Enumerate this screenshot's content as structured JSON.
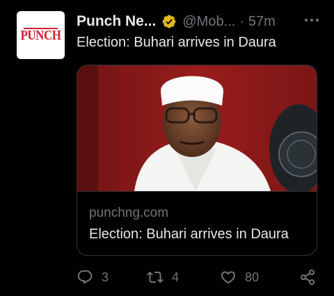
{
  "avatar": {
    "logo_text": "PUNCH"
  },
  "header": {
    "display_name": "Punch Ne...",
    "handle": "@Mob...",
    "separator": "·",
    "time": "57m"
  },
  "tweet": {
    "text": "Election: Buhari arrives in Daura"
  },
  "card": {
    "domain": "punchng.com",
    "title": "Election: Buhari arrives in Daura"
  },
  "actions": {
    "reply_count": "3",
    "retweet_count": "4",
    "like_count": "80"
  },
  "colors": {
    "background": "#000000",
    "text_primary": "#e7e9ea",
    "text_secondary": "#71767b",
    "border": "#2f3336",
    "verified_badge": "#e2b719",
    "brand_red": "#d0202e"
  }
}
